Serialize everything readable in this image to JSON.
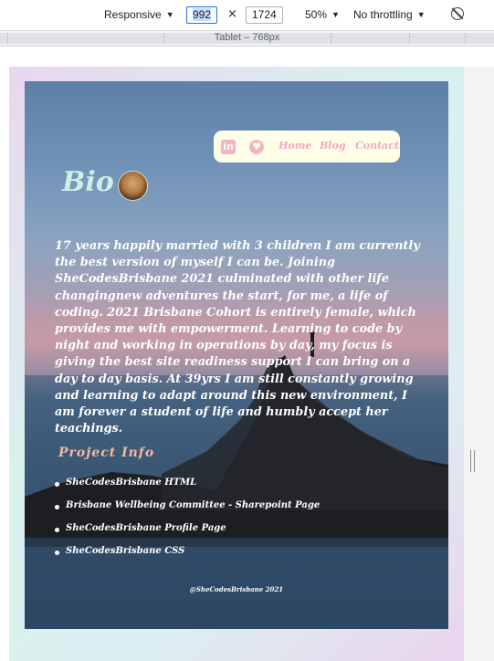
{
  "devtools": {
    "device": "Responsive",
    "width": "992",
    "height": "1724",
    "times_symbol": "×",
    "zoom": "50%",
    "throttling": "No throttling",
    "media_query_label": "Tablet – 768px"
  },
  "site": {
    "nav": {
      "linkedin_glyph": "in",
      "home": "Home",
      "blog": "Blog",
      "contact": "Contact"
    },
    "bio_title": "Bio",
    "bio_text": "17 years happily married with 3 children I am currently the best version of myself I can be. Joining SheCodesBrisbane 2021 culminated with other life changingnew adventures the start, for me, a life of coding. 2021 Brisbane Cohort is entirely female, which provides me with empowerment. Learning to code by night and working in operations by day, my focus is giving the best site readiness support I can bring on a day to day basis. At 39yrs I am still constantly growing and learning to adapt around this new environment, I am forever a student of life and humbly accept her teachings.",
    "project_title": "Project Info",
    "projects": [
      "SheCodesBrisbane HTML",
      "Brisbane Wellbeing Committee - Sharepoint Page",
      "SheCodesBrisbane Profile Page",
      "SheCodesBrisbane CSS"
    ],
    "footer": "@SheCodesBrisbane 2021"
  }
}
